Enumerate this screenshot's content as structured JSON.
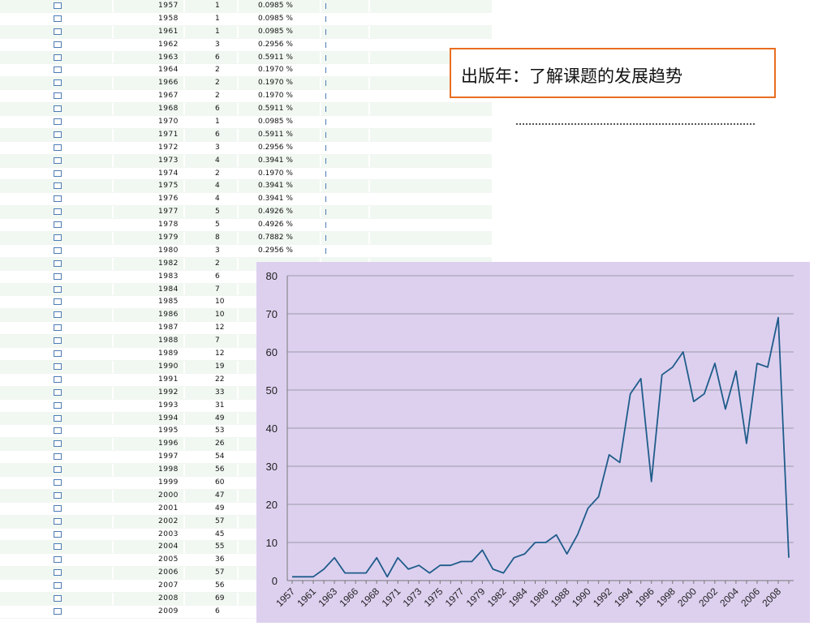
{
  "title": "出版年：了解课题的发展趋势",
  "table": {
    "rows": [
      {
        "year": "1957",
        "count": "1",
        "pct": "0.0985 %"
      },
      {
        "year": "1958",
        "count": "1",
        "pct": "0.0985 %"
      },
      {
        "year": "1961",
        "count": "1",
        "pct": "0.0985 %"
      },
      {
        "year": "1962",
        "count": "3",
        "pct": "0.2956 %"
      },
      {
        "year": "1963",
        "count": "6",
        "pct": "0.5911 %"
      },
      {
        "year": "1964",
        "count": "2",
        "pct": "0.1970 %"
      },
      {
        "year": "1966",
        "count": "2",
        "pct": "0.1970 %"
      },
      {
        "year": "1967",
        "count": "2",
        "pct": "0.1970 %"
      },
      {
        "year": "1968",
        "count": "6",
        "pct": "0.5911 %"
      },
      {
        "year": "1970",
        "count": "1",
        "pct": "0.0985 %"
      },
      {
        "year": "1971",
        "count": "6",
        "pct": "0.5911 %"
      },
      {
        "year": "1972",
        "count": "3",
        "pct": "0.2956 %"
      },
      {
        "year": "1973",
        "count": "4",
        "pct": "0.3941 %"
      },
      {
        "year": "1974",
        "count": "2",
        "pct": "0.1970 %"
      },
      {
        "year": "1975",
        "count": "4",
        "pct": "0.3941 %"
      },
      {
        "year": "1976",
        "count": "4",
        "pct": "0.3941 %"
      },
      {
        "year": "1977",
        "count": "5",
        "pct": "0.4926 %"
      },
      {
        "year": "1978",
        "count": "5",
        "pct": "0.4926 %"
      },
      {
        "year": "1979",
        "count": "8",
        "pct": "0.7882 %"
      },
      {
        "year": "1980",
        "count": "3",
        "pct": "0.2956 %"
      },
      {
        "year": "1982",
        "count": "2",
        "pct": ""
      },
      {
        "year": "1983",
        "count": "6",
        "pct": ""
      },
      {
        "year": "1984",
        "count": "7",
        "pct": ""
      },
      {
        "year": "1985",
        "count": "10",
        "pct": ""
      },
      {
        "year": "1986",
        "count": "10",
        "pct": ""
      },
      {
        "year": "1987",
        "count": "12",
        "pct": ""
      },
      {
        "year": "1988",
        "count": "7",
        "pct": ""
      },
      {
        "year": "1989",
        "count": "12",
        "pct": ""
      },
      {
        "year": "1990",
        "count": "19",
        "pct": ""
      },
      {
        "year": "1991",
        "count": "22",
        "pct": ""
      },
      {
        "year": "1992",
        "count": "33",
        "pct": ""
      },
      {
        "year": "1993",
        "count": "31",
        "pct": ""
      },
      {
        "year": "1994",
        "count": "49",
        "pct": ""
      },
      {
        "year": "1995",
        "count": "53",
        "pct": ""
      },
      {
        "year": "1996",
        "count": "26",
        "pct": ""
      },
      {
        "year": "1997",
        "count": "54",
        "pct": ""
      },
      {
        "year": "1998",
        "count": "56",
        "pct": ""
      },
      {
        "year": "1999",
        "count": "60",
        "pct": ""
      },
      {
        "year": "2000",
        "count": "47",
        "pct": ""
      },
      {
        "year": "2001",
        "count": "49",
        "pct": ""
      },
      {
        "year": "2002",
        "count": "57",
        "pct": ""
      },
      {
        "year": "2003",
        "count": "45",
        "pct": ""
      },
      {
        "year": "2004",
        "count": "55",
        "pct": ""
      },
      {
        "year": "2005",
        "count": "36",
        "pct": ""
      },
      {
        "year": "2006",
        "count": "57",
        "pct": ""
      },
      {
        "year": "2007",
        "count": "56",
        "pct": ""
      },
      {
        "year": "2008",
        "count": "69",
        "pct": ""
      },
      {
        "year": "2009",
        "count": "6",
        "pct": ""
      }
    ]
  },
  "colors": {
    "checkbox_border": "#4e7bb4",
    "row_stripe": "#f1f8f1",
    "title_border": "#e96e20",
    "chart_background": "#ddd0ef",
    "line": "#1f5c8a",
    "gridline": "#9a9aa8"
  },
  "chart_data": {
    "type": "line",
    "x": [
      "1957",
      "1958",
      "1961",
      "1962",
      "1963",
      "1964",
      "1966",
      "1967",
      "1968",
      "1970",
      "1971",
      "1972",
      "1973",
      "1974",
      "1975",
      "1976",
      "1977",
      "1978",
      "1979",
      "1980",
      "1982",
      "1983",
      "1984",
      "1985",
      "1986",
      "1987",
      "1988",
      "1989",
      "1990",
      "1991",
      "1992",
      "1993",
      "1994",
      "1995",
      "1996",
      "1997",
      "1998",
      "1999",
      "2000",
      "2001",
      "2002",
      "2003",
      "2004",
      "2005",
      "2006",
      "2007",
      "2008",
      "2009"
    ],
    "values": [
      1,
      1,
      1,
      3,
      6,
      2,
      2,
      2,
      6,
      1,
      6,
      3,
      4,
      2,
      4,
      4,
      5,
      5,
      8,
      3,
      2,
      6,
      7,
      10,
      10,
      12,
      7,
      12,
      19,
      22,
      33,
      31,
      49,
      53,
      26,
      54,
      56,
      60,
      47,
      49,
      57,
      45,
      55,
      36,
      57,
      56,
      69,
      6
    ],
    "yticks": [
      "0",
      "10",
      "20",
      "30",
      "40",
      "50",
      "60",
      "70",
      "80"
    ],
    "ylim": [
      0,
      80
    ],
    "grid": true,
    "legend": "none"
  }
}
